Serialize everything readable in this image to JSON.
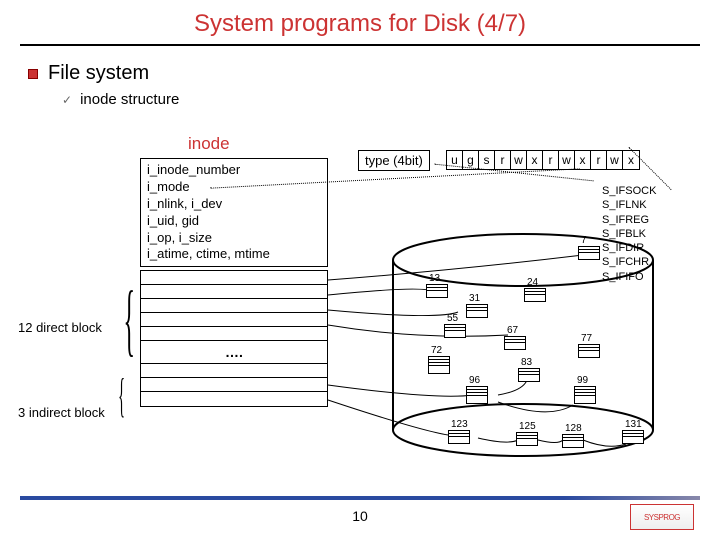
{
  "title": "System programs for Disk (4/7)",
  "bullet1": "File system",
  "bullet2": "inode structure",
  "inode_header": "inode",
  "fields": {
    "f1": "i_inode_number",
    "f2": "i_mode",
    "f3": "i_nlink, i_dev",
    "f4": "i_uid, gid",
    "f5": "i_op, i_size",
    "f6": "i_atime, ctime, mtime"
  },
  "dots": "….",
  "direct_label": "12 direct block",
  "indirect_label": "3 indirect block",
  "type_label": "type (4bit)",
  "perm": [
    "u",
    "g",
    "s",
    "r",
    "w",
    "x",
    "r",
    "w",
    "x",
    "r",
    "w",
    "x"
  ],
  "types": {
    "t1": "S_IFSOCK",
    "t2": "S_IFLNK",
    "t3": "S_IFREG",
    "t4": "S_IFBLK",
    "t5": "S_IFDIR",
    "t6": "S_IFCHR",
    "t7": "S_IFIFO"
  },
  "disk": {
    "n7": "7",
    "n13": "13",
    "n24": "24",
    "n31": "31",
    "n55": "55",
    "n67": "67",
    "n72": "72",
    "n77": "77",
    "n83": "83",
    "n96": "96",
    "n99": "99",
    "n123": "123",
    "n125": "125",
    "n128": "128",
    "n131": "131"
  },
  "page": "10",
  "logo": "SYSPROG"
}
